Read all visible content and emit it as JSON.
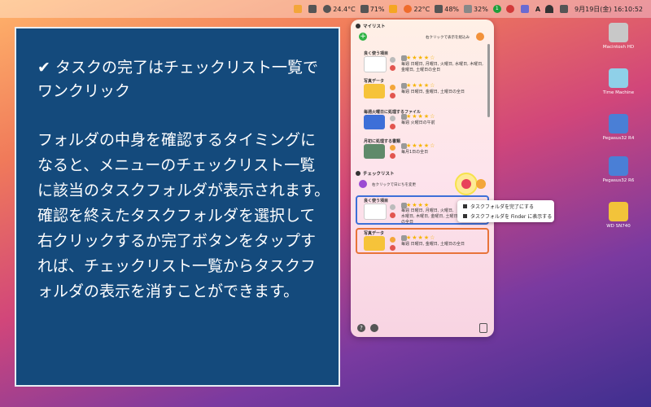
{
  "menubar": {
    "temp1": "24.4°C",
    "battery1": "71%",
    "temp2": "22°C",
    "battery2": "48%",
    "battery3": "32%",
    "badge": "1",
    "app_a": "A",
    "datetime": "9月19日(金) 16:10:52"
  },
  "panel": {
    "title": "✔ タスクの完了はチェックリスト一覧でワンクリック",
    "body": "フォルダの中身を確認するタイミングになると、メニューのチェックリスト一覧に該当のタスクフォルダが表示されます。\n確認を終えたタスクフォルダを選択して右クリックするか完了ボタンをタップすれば、チェックリスト一覧からタスクフォルダの表示を消すことができます。"
  },
  "list": {
    "mylist_label": "マイリスト",
    "right_click_hint": "右クリックで表示を組込み",
    "items": [
      {
        "name": "良く使う項目",
        "schedule": "毎週 日曜日, 月曜日, 火曜日, 水曜日, 木曜日, 金曜日, 土曜日の全日"
      },
      {
        "name": "写真データ",
        "schedule": "毎週 日曜日, 金曜日, 土曜日の全日"
      },
      {
        "name": "毎週火曜日に処理するファイル",
        "schedule": "毎週 火曜日の午前"
      },
      {
        "name": "月初に処理する書類",
        "schedule": "毎月1日の全日"
      }
    ],
    "checklist_label": "チェックリスト",
    "checklist_hint": "右クリックで日にちを変更",
    "check_items": [
      {
        "name": "良く使う項目",
        "schedule": "毎週 日曜日, 月曜日, 火曜日, 水曜日, 木曜日, 金曜日, 土曜日の全日"
      },
      {
        "name": "写真データ",
        "schedule": "毎週 日曜日, 金曜日, 土曜日の全日"
      }
    ],
    "help_icon": "?"
  },
  "context_menu": {
    "complete": "タスクフォルダを完了にする",
    "finder": "タスクフォルダを Finder に表示する"
  },
  "desktop": {
    "icons": [
      "Macintosh HD",
      "Time Machine",
      "Pegasus32 R4",
      "Pegasus32 R6",
      "WD SN740"
    ]
  },
  "colors": {
    "panel_bg": "#144a7c",
    "accent_green": "#2fb344",
    "star": "#f5b400"
  }
}
